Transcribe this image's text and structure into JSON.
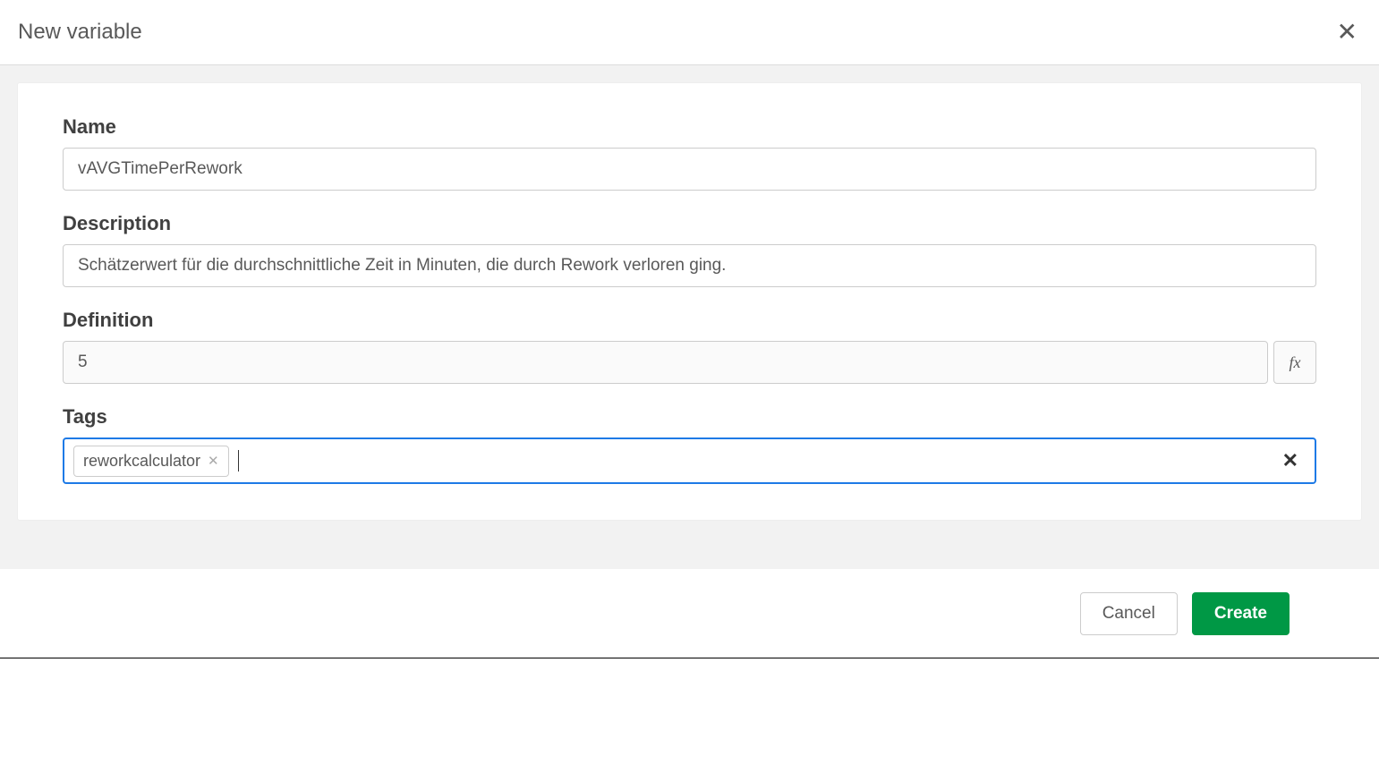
{
  "dialog": {
    "title": "New variable"
  },
  "fields": {
    "name": {
      "label": "Name",
      "value": "vAVGTimePerRework"
    },
    "description": {
      "label": "Description",
      "value": "Schätzerwert für die durchschnittliche Zeit in Minuten, die durch Rework verloren ging."
    },
    "definition": {
      "label": "Definition",
      "value": "5",
      "fx_label": "fx"
    },
    "tags": {
      "label": "Tags",
      "items": [
        "reworkcalculator"
      ]
    }
  },
  "buttons": {
    "cancel": "Cancel",
    "create": "Create"
  }
}
